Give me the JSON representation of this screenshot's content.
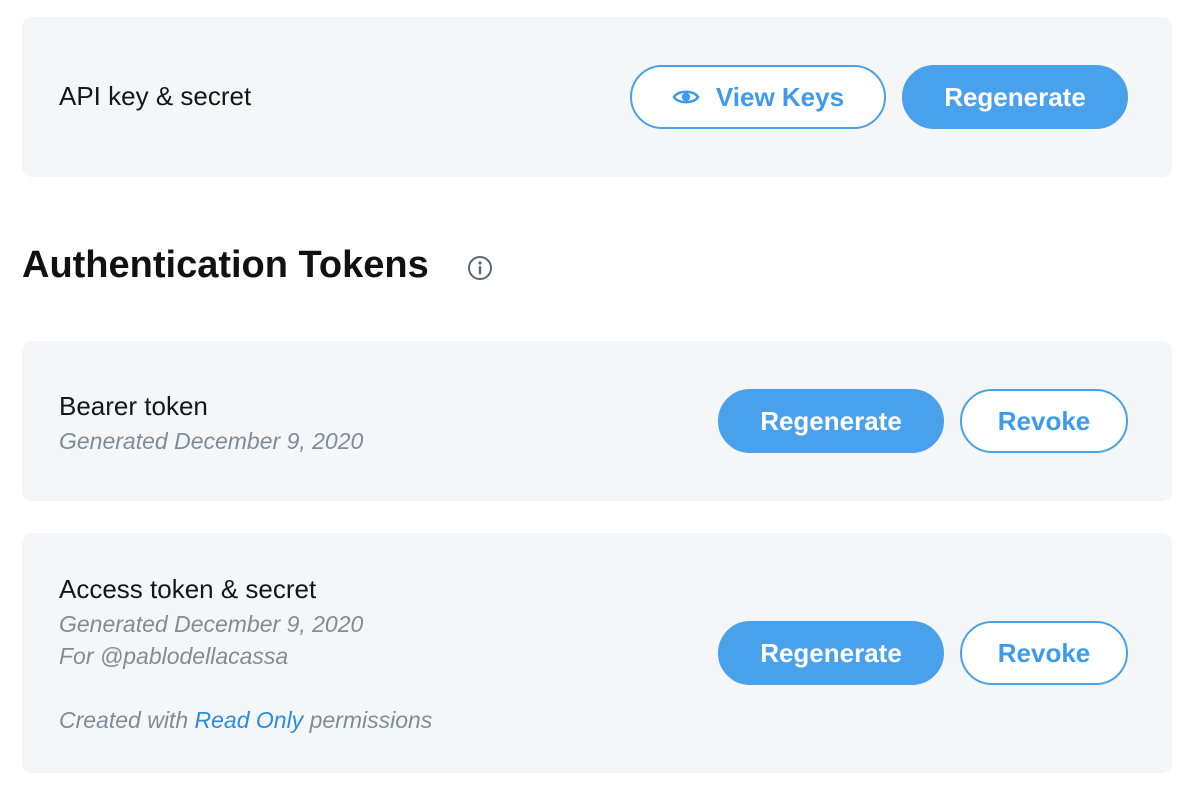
{
  "api_card": {
    "label": "API key & secret",
    "view_keys_label": "View Keys",
    "regenerate_label": "Regenerate"
  },
  "auth_section": {
    "heading": "Authentication Tokens"
  },
  "bearer_card": {
    "label": "Bearer token",
    "generated": "Generated December 9, 2020",
    "regenerate_label": "Regenerate",
    "revoke_label": "Revoke"
  },
  "access_card": {
    "label": "Access token & secret",
    "generated": "Generated December 9, 2020",
    "for_user": "For @pablodellacassa",
    "perm_prefix": "Created with",
    "perm_link": "Read Only",
    "perm_suffix": "permissions",
    "regenerate_label": "Regenerate",
    "revoke_label": "Revoke"
  },
  "icons": {
    "eye": "eye-icon",
    "info": "info-icon"
  },
  "colors": {
    "accent": "#4aa1eb",
    "card_bg": "#f5f6f8",
    "muted_text": "#7f8c99",
    "link": "#2a8ce0"
  }
}
